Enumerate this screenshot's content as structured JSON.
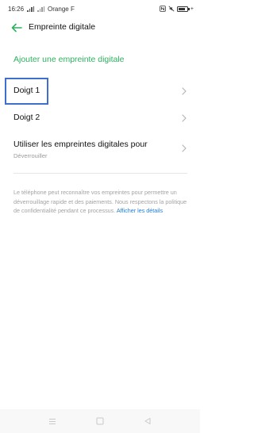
{
  "status_bar": {
    "time": "16:26",
    "carrier": "Orange F",
    "battery_level": 0.85,
    "icons": [
      "signal-icon",
      "nfc-icon",
      "mute-icon",
      "battery-icon"
    ]
  },
  "app_bar": {
    "title": "Empreinte digitale",
    "back_icon": "back-arrow-icon",
    "accent_color": "#2fb15f"
  },
  "content": {
    "add_label": "Ajouter une empreinte digitale",
    "fingers": [
      {
        "label": "Doigt 1"
      },
      {
        "label": "Doigt 2"
      }
    ],
    "unlock": {
      "label": "Utiliser les empreintes digitales pour",
      "sub": "Déverrouiller"
    },
    "description": "Le téléphone peut reconnaître vos empreintes pour permettre un déverrouillage rapide et des paiements. Nous respectons la politique de confidentialité pendant ce processus.",
    "details_link": "Afficher les détails"
  },
  "nav_bar": {
    "buttons": [
      "menu-icon",
      "home-icon",
      "back-icon"
    ]
  }
}
